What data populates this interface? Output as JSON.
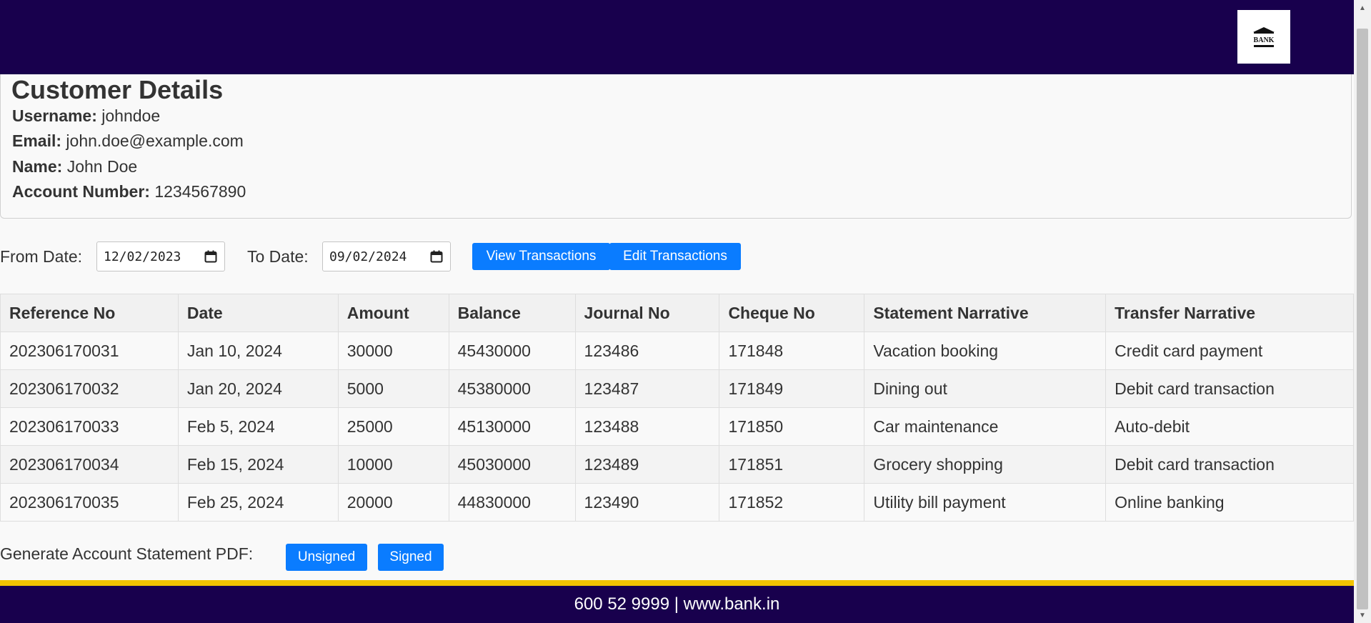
{
  "header": {
    "logo_text": "BANK",
    "logo_icon": "bank-building-icon",
    "background": "#18004d"
  },
  "customer": {
    "title": "Customer Details",
    "username_label": "Username:",
    "username": "johndoe",
    "email_label": "Email:",
    "email": "john.doe@example.com",
    "name_label": "Name:",
    "name": "John Doe",
    "account_label": "Account Number:",
    "account_number": "1234567890"
  },
  "filters": {
    "from_label": "From Date:",
    "from_value": "12/02/2023",
    "to_label": "To Date:",
    "to_value": "09/02/2024",
    "view_button": "View Transactions",
    "edit_button": "Edit Transactions",
    "button_color": "#0a7cff"
  },
  "table": {
    "columns": [
      "Reference No",
      "Date",
      "Amount",
      "Balance",
      "Journal No",
      "Cheque No",
      "Statement Narrative",
      "Transfer Narrative"
    ],
    "rows": [
      [
        "202306170031",
        "Jan 10, 2024",
        "30000",
        "45430000",
        "123486",
        "171848",
        "Vacation booking",
        "Credit card payment"
      ],
      [
        "202306170032",
        "Jan 20, 2024",
        "5000",
        "45380000",
        "123487",
        "171849",
        "Dining out",
        "Debit card transaction"
      ],
      [
        "202306170033",
        "Feb 5, 2024",
        "25000",
        "45130000",
        "123488",
        "171850",
        "Car maintenance",
        "Auto-debit"
      ],
      [
        "202306170034",
        "Feb 15, 2024",
        "10000",
        "45030000",
        "123489",
        "171851",
        "Grocery shopping",
        "Debit card transaction"
      ],
      [
        "202306170035",
        "Feb 25, 2024",
        "20000",
        "44830000",
        "123490",
        "171852",
        "Utility bill payment",
        "Online banking"
      ]
    ]
  },
  "pdf": {
    "label": "Generate Account Statement PDF:",
    "unsigned_button": "Unsigned",
    "signed_button": "Signed"
  },
  "footer": {
    "text": "600 52 9999 | www.bank.in",
    "accent": "#f2c300"
  }
}
